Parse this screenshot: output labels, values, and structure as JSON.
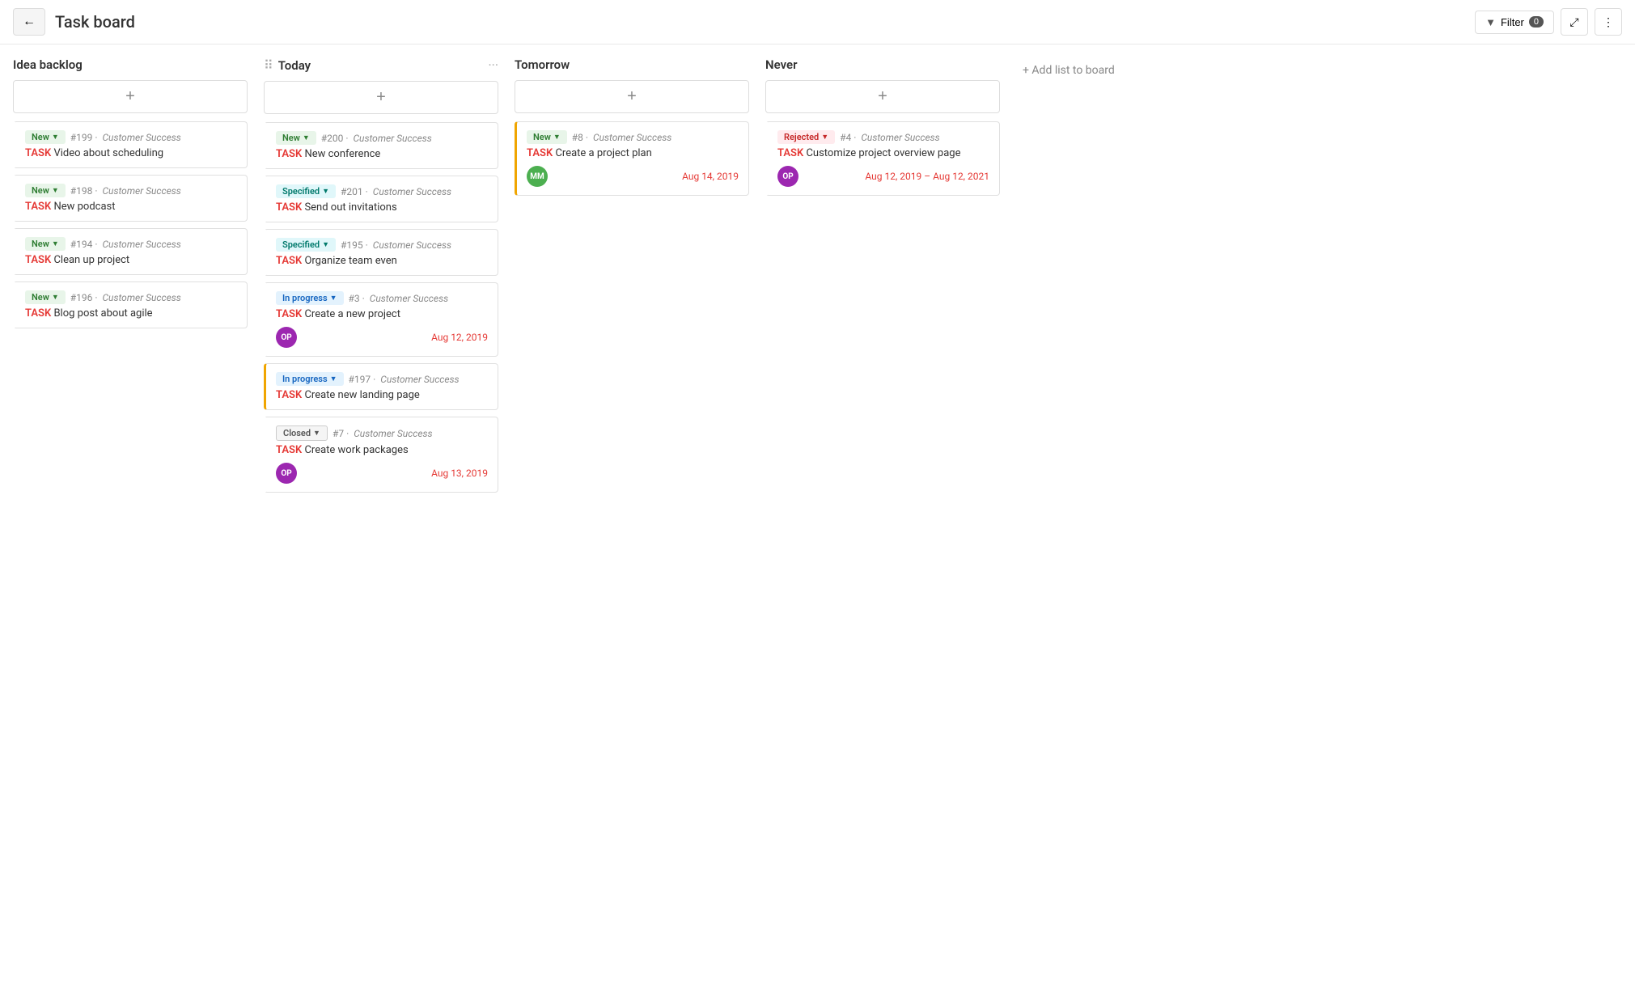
{
  "header": {
    "back_label": "←",
    "title": "Task board",
    "filter_label": "Filter",
    "filter_count": "0",
    "fullscreen_icon": "⤢",
    "more_icon": "⋮"
  },
  "add_list_label": "+ Add list to board",
  "columns": [
    {
      "id": "idea-backlog",
      "title": "Idea backlog",
      "has_drag_handle": false,
      "has_more": false,
      "cards": [
        {
          "id": "card-199",
          "status": "New",
          "status_type": "new",
          "number": "#199",
          "project": "Customer Success",
          "task_label": "TASK",
          "title": "Video about scheduling",
          "has_avatar": false,
          "date": "",
          "border": ""
        },
        {
          "id": "card-198",
          "status": "New",
          "status_type": "new",
          "number": "#198",
          "project": "Customer Success",
          "task_label": "TASK",
          "title": "New podcast",
          "has_avatar": false,
          "date": "",
          "border": ""
        },
        {
          "id": "card-194",
          "status": "New",
          "status_type": "new",
          "number": "#194",
          "project": "Customer Success",
          "task_label": "TASK",
          "title": "Clean up project",
          "has_avatar": false,
          "date": "",
          "border": ""
        },
        {
          "id": "card-196",
          "status": "New",
          "status_type": "new",
          "number": "#196",
          "project": "Customer Success",
          "task_label": "TASK",
          "title": "Blog post about agile",
          "has_avatar": false,
          "date": "",
          "border": ""
        }
      ]
    },
    {
      "id": "today",
      "title": "Today",
      "has_drag_handle": true,
      "has_more": true,
      "cards": [
        {
          "id": "card-200",
          "status": "New",
          "status_type": "new",
          "number": "#200",
          "project": "Customer Success",
          "task_label": "TASK",
          "title": "New conference",
          "has_avatar": false,
          "date": "",
          "border": ""
        },
        {
          "id": "card-201",
          "status": "Specified",
          "status_type": "specified",
          "number": "#201",
          "project": "Customer Success",
          "task_label": "TASK",
          "title": "Send out invitations",
          "has_avatar": false,
          "date": "",
          "border": ""
        },
        {
          "id": "card-195",
          "status": "Specified",
          "status_type": "specified",
          "number": "#195",
          "project": "Customer Success",
          "task_label": "TASK",
          "title": "Organize team even",
          "has_avatar": false,
          "date": "",
          "border": ""
        },
        {
          "id": "card-3",
          "status": "In progress",
          "status_type": "inprogress",
          "number": "#3",
          "project": "Customer Success",
          "task_label": "TASK",
          "title": "Create a new project",
          "has_avatar": true,
          "avatar_type": "op",
          "avatar_initials": "OP",
          "date": "Aug 12, 2019",
          "border": ""
        },
        {
          "id": "card-197",
          "status": "In progress",
          "status_type": "inprogress",
          "number": "#197",
          "project": "Customer Success",
          "task_label": "TASK",
          "title": "Create new landing page",
          "has_avatar": false,
          "date": "",
          "border": "yellow"
        },
        {
          "id": "card-7",
          "status": "Closed",
          "status_type": "closed",
          "number": "#7",
          "project": "Customer Success",
          "task_label": "TASK",
          "title": "Create work packages",
          "has_avatar": true,
          "avatar_type": "op",
          "avatar_initials": "OP",
          "date": "Aug 13, 2019",
          "border": ""
        }
      ]
    },
    {
      "id": "tomorrow",
      "title": "Tomorrow",
      "has_drag_handle": false,
      "has_more": false,
      "cards": [
        {
          "id": "card-8",
          "status": "New",
          "status_type": "new",
          "number": "#8",
          "project": "Customer Success",
          "task_label": "TASK",
          "title": "Create a project plan",
          "has_avatar": true,
          "avatar_type": "mm",
          "avatar_initials": "MM",
          "date": "Aug 14, 2019",
          "border": "yellow"
        }
      ]
    },
    {
      "id": "never",
      "title": "Never",
      "has_drag_handle": false,
      "has_more": false,
      "cards": [
        {
          "id": "card-4",
          "status": "Rejected",
          "status_type": "rejected",
          "number": "#4",
          "project": "Customer Success",
          "task_label": "TASK",
          "title": "Customize project overview page",
          "has_avatar": true,
          "avatar_type": "op",
          "avatar_initials": "OP",
          "date": "Aug 12, 2019 – Aug 12, 2021",
          "border": ""
        }
      ]
    }
  ]
}
